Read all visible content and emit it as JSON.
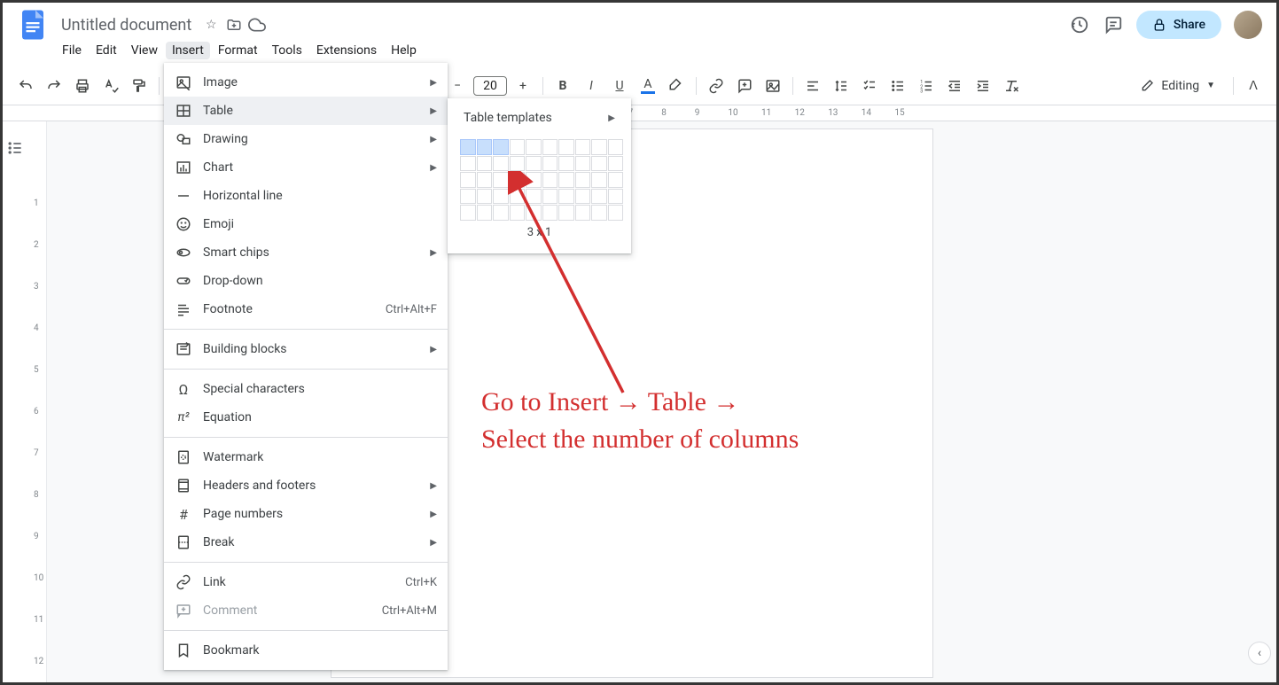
{
  "header": {
    "doc_title": "Untitled document",
    "share_label": "Share"
  },
  "menubar": [
    "File",
    "Edit",
    "View",
    "Insert",
    "Format",
    "Tools",
    "Extensions",
    "Help"
  ],
  "menubar_active_index": 3,
  "toolbar": {
    "font_size": "20",
    "editing_label": "Editing"
  },
  "dropdown_items": [
    {
      "icon": "image",
      "label": "Image",
      "arrow": true
    },
    {
      "icon": "table",
      "label": "Table",
      "arrow": true,
      "highlight": true
    },
    {
      "icon": "drawing",
      "label": "Drawing",
      "arrow": true
    },
    {
      "icon": "chart",
      "label": "Chart",
      "arrow": true
    },
    {
      "icon": "hr",
      "label": "Horizontal line"
    },
    {
      "icon": "emoji",
      "label": "Emoji"
    },
    {
      "icon": "smartchips",
      "label": "Smart chips",
      "arrow": true
    },
    {
      "icon": "dropdown",
      "label": "Drop-down"
    },
    {
      "icon": "footnote",
      "label": "Footnote",
      "shortcut": "Ctrl+Alt+F"
    },
    {
      "sep": true
    },
    {
      "icon": "blocks",
      "label": "Building blocks",
      "arrow": true
    },
    {
      "sep": true
    },
    {
      "icon": "special",
      "label": "Special characters"
    },
    {
      "icon": "equation",
      "label": "Equation"
    },
    {
      "sep": true
    },
    {
      "icon": "watermark",
      "label": "Watermark"
    },
    {
      "icon": "headers",
      "label": "Headers and footers",
      "arrow": true
    },
    {
      "icon": "pagenum",
      "label": "Page numbers",
      "arrow": true
    },
    {
      "icon": "break",
      "label": "Break",
      "arrow": true
    },
    {
      "sep": true
    },
    {
      "icon": "link",
      "label": "Link",
      "shortcut": "Ctrl+K"
    },
    {
      "icon": "comment",
      "label": "Comment",
      "shortcut": "Ctrl+Alt+M",
      "disabled": true
    },
    {
      "sep": true
    },
    {
      "icon": "bookmark",
      "label": "Bookmark"
    }
  ],
  "submenu": {
    "templates_label": "Table templates",
    "grid_cols": 10,
    "grid_rows": 5,
    "sel_cols": 3,
    "sel_rows": 1,
    "size_label": "3 x 1"
  },
  "ruler_marks": [
    "1",
    "2",
    "3",
    "4",
    "5",
    "6",
    "7",
    "8",
    "9",
    "10",
    "11",
    "12",
    "13",
    "14",
    "15"
  ],
  "annotation": {
    "line1": "Go to Insert → Table →",
    "line2": "Select the number of columns"
  }
}
